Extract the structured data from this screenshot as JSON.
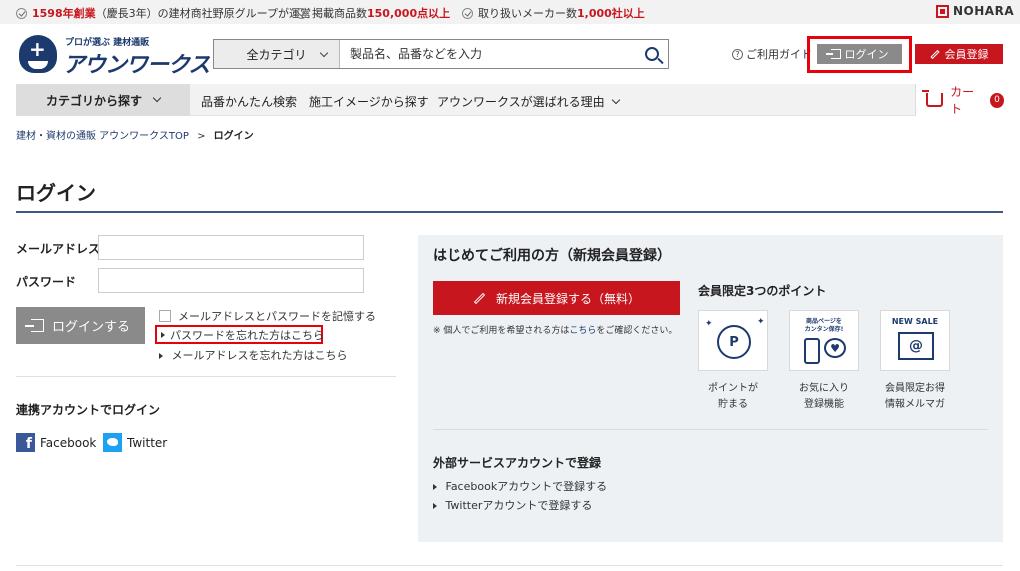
{
  "topbar": {
    "item1_highlight": "1598年創業",
    "item1_rest": "（慶長3年）の建材商社野原グループが運営",
    "item2_pre": "掲載商品数",
    "item2_highlight": "150,000点以上",
    "item3_pre": "取り扱いメーカー数",
    "item3_highlight": "1,000社以上",
    "nohara": "NOHARA"
  },
  "header": {
    "logo_sub": "プロが選ぶ 建材通販",
    "logo_main": "アウンワークス",
    "search_category": "全カテゴリ",
    "search_placeholder": "製品名、品番などを入力",
    "guide": "ご利用ガイド",
    "login": "ログイン",
    "register": "会員登録"
  },
  "nav": {
    "category": "カテゴリから探す",
    "items": [
      "品番かんたん検索",
      "施工イメージから探す",
      "アウンワークスが選ばれる理由"
    ],
    "cart": "カート",
    "cart_count": "0"
  },
  "breadcrumb": {
    "home": "建材・資材の通販 アウンワークスTOP",
    "separator": ">",
    "current": "ログイン"
  },
  "page": {
    "title": "ログイン"
  },
  "login_form": {
    "email_label": "メールアドレス",
    "password_label": "パスワード",
    "submit": "ログインする",
    "remember": "メールアドレスとパスワードを記憶する",
    "forgot_password": "パスワードを忘れた方はこちら",
    "forgot_email": "メールアドレスを忘れた方はこちら"
  },
  "sns": {
    "title": "連携アカウントでログイン",
    "facebook": "Facebook",
    "twitter": "Twitter"
  },
  "register": {
    "title": "はじめてご利用の方（新規会員登録）",
    "button": "新規会員登録する（無料）",
    "note_pre": "※ 個人でご利用を希望される方は",
    "note_link": "こちら",
    "note_post": "をご確認ください。",
    "points_title": "会員限定3つのポイント",
    "points": [
      {
        "line1": "ポイントが",
        "line2": "貯まる",
        "icon": "points-coin-icon",
        "badge": "P"
      },
      {
        "line1": "お気に入り",
        "line2": "登録機能",
        "icon": "favorite-phone-icon",
        "badge_line1": "商品ページを",
        "badge_line2": "カンタン保存!"
      },
      {
        "line1": "会員限定お得",
        "line2": "情報メルマガ",
        "icon": "newsletter-envelope-icon",
        "badge": "NEW    SALE"
      }
    ],
    "external_title": "外部サービスアカウントで登録",
    "external_facebook": "Facebookアカウントで登録する",
    "external_twitter": "Twitterアカウントで登録する"
  },
  "colors": {
    "brand_navy": "#1d3a6e",
    "accent_red": "#c8161e",
    "highlight_border": "#e8000a",
    "button_gray": "#8a8a8a"
  }
}
